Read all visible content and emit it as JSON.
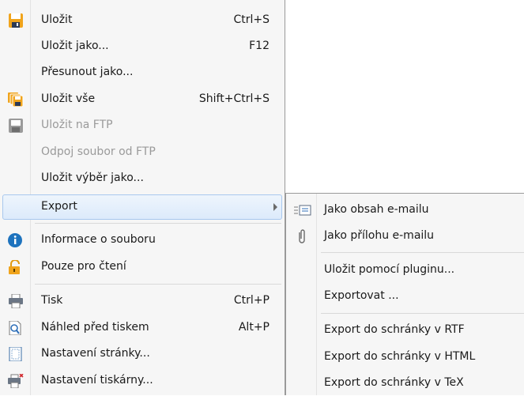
{
  "menu": {
    "items": [
      {
        "label": "Uložit",
        "shortcut": "Ctrl+S",
        "icon": "save-icon"
      },
      {
        "label": "Uložit jako...",
        "shortcut": "F12"
      },
      {
        "label": "Přesunout jako..."
      },
      {
        "label": "Uložit vše",
        "shortcut": "Shift+Ctrl+S",
        "icon": "save-all-icon"
      },
      {
        "label": "Uložit na FTP",
        "icon": "ftp-icon",
        "disabled": true
      },
      {
        "label": "Odpoj soubor od FTP",
        "disabled": true
      },
      {
        "label": "Uložit výběr jako..."
      },
      {
        "label": "Export",
        "has_submenu": true,
        "highlighted": true
      },
      {
        "label": "Informace o souboru",
        "icon": "info-icon"
      },
      {
        "label": "Pouze pro čtení",
        "icon": "lock-icon"
      },
      {
        "label": "Tisk",
        "shortcut": "Ctrl+P",
        "icon": "printer-icon"
      },
      {
        "label": "Náhled před tiskem",
        "shortcut": "Alt+P",
        "icon": "print-preview-icon"
      },
      {
        "label": "Nastavení stránky...",
        "icon": "page-setup-icon"
      },
      {
        "label": "Nastavení tiskárny...",
        "icon": "printer-settings-icon"
      }
    ]
  },
  "submenu": {
    "items": [
      {
        "label": "Jako obsah e-mailu",
        "icon": "email-body-icon"
      },
      {
        "label": "Jako přílohu e-mailu",
        "icon": "paperclip-icon"
      },
      {
        "label": "Uložit pomocí pluginu..."
      },
      {
        "label": "Exportovat ..."
      },
      {
        "label": "Export do schránky v RTF"
      },
      {
        "label": "Export do schránky v HTML"
      },
      {
        "label": "Export do schránky v TeX"
      }
    ]
  },
  "colors": {
    "menu_bg": "#f6f6f6",
    "highlight_border": "#a8c8ee",
    "disabled_text": "#9a9a9a",
    "save_icon": "#f0a41c",
    "info_icon": "#1e73be"
  }
}
